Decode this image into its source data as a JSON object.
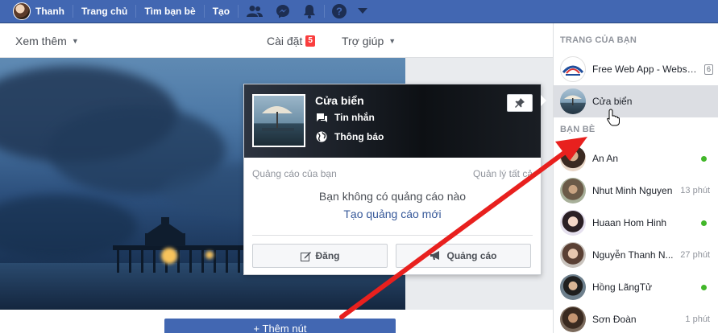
{
  "topbar": {
    "user_name": "Thanh",
    "links": [
      "Trang chủ",
      "Tìm bạn bè",
      "Tạo"
    ],
    "icons": [
      "friends-icon",
      "messenger-icon",
      "notifications-icon",
      "help-icon",
      "chevron-down-icon"
    ],
    "color": "#4267b2"
  },
  "subnav": {
    "more": "Xem thêm",
    "settings": "Cài đặt",
    "settings_badge": "5",
    "help": "Trợ giúp"
  },
  "add_button": "+ Thêm nút",
  "hovercard": {
    "page_name": "Cửa biển",
    "messages": "Tin nhắn",
    "notifications": "Thông báo",
    "ads_label": "Quảng cáo của bạn",
    "manage_all": "Quản lý tất cả",
    "no_ads": "Bạn không có quảng cáo nào",
    "new_ad": "Tạo quảng cáo mới",
    "post_button": "Đăng",
    "promote_button": "Quảng cáo"
  },
  "sidebar": {
    "pages_heading": "TRANG CỦA BẠN",
    "pages": [
      {
        "name": "Free Web App - Websi...",
        "count": "6"
      },
      {
        "name": "Cửa biển"
      }
    ],
    "friends_heading": "BẠN BÈ",
    "friends": [
      {
        "name": "An An",
        "status": "online"
      },
      {
        "name": "Nhut Minh Nguyen",
        "time": "13 phút"
      },
      {
        "name": "Huaan Hom Hinh",
        "status": "online"
      },
      {
        "name": "Nguyễn Thanh N...",
        "time": "27 phút"
      },
      {
        "name": "Hồng LãngTử",
        "status": "online"
      },
      {
        "name": "Sơn Đoàn",
        "time": "1 phút"
      }
    ],
    "online_color": "#42b72a"
  }
}
